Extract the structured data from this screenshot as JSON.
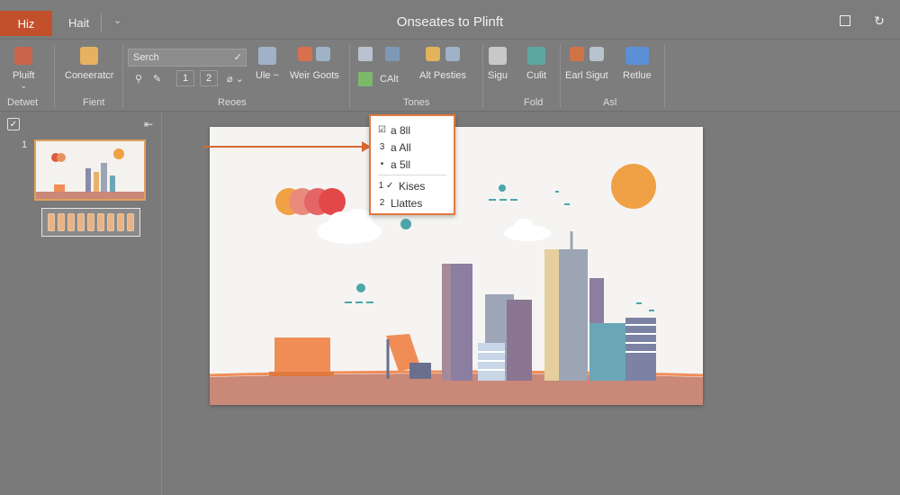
{
  "titlebar": {
    "tabs": [
      "Hiz",
      "Hait"
    ],
    "title": "Onseates to Plinft"
  },
  "ribbon": {
    "buttons": [
      {
        "label": "Pluift"
      },
      {
        "label": "Coneeratcr"
      },
      {
        "label": "Ule ~"
      },
      {
        "label": "Weir Goots"
      },
      {
        "label": "CAlt"
      },
      {
        "label": "Alt Pesties"
      },
      {
        "label": "Sigu"
      },
      {
        "label": "Culit"
      },
      {
        "label": "Earl Sigut"
      },
      {
        "label": "Retlue"
      }
    ],
    "search_placeholder": "Serch",
    "spinner_values": [
      "1",
      "2"
    ],
    "groups": [
      "Detwet",
      "Fient",
      "Reoes",
      "Tones",
      "Fold",
      "Asl"
    ]
  },
  "panel": {
    "slide_number": "1"
  },
  "popup": {
    "items": [
      {
        "icon": "☑",
        "label": "a 8ll"
      },
      {
        "icon": "3",
        "label": "a All"
      },
      {
        "icon": "•",
        "label": "a 5ll"
      },
      {
        "icon": "1 ✓",
        "label": "Kises"
      },
      {
        "icon": "2",
        "label": "Llattes"
      }
    ]
  },
  "colors": {
    "accent": "#c2502c",
    "slide_sun": "#f0a045",
    "slide_ground": "#c98878",
    "popup_border": "#e07a3e"
  }
}
